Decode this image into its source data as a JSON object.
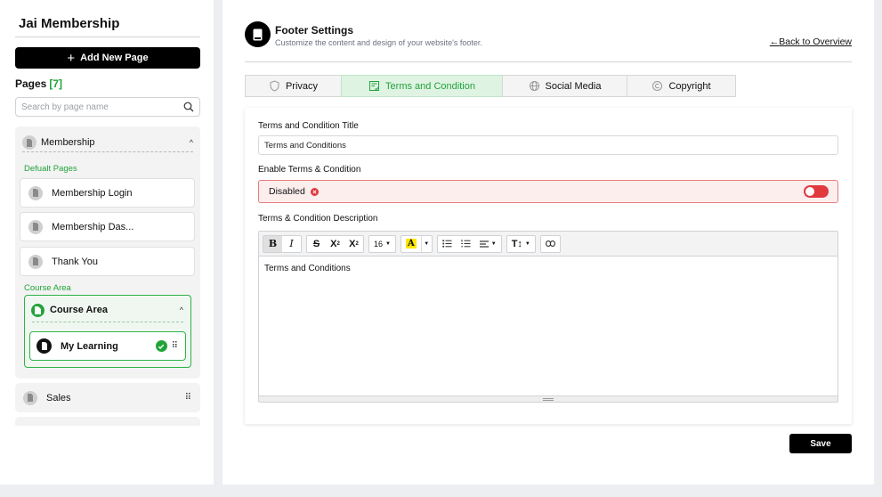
{
  "sidebar": {
    "app_title": "Jai Membership",
    "add_button": "Add New Page",
    "pages_label": "Pages",
    "pages_count": "[7]",
    "search_placeholder": "Search by page name",
    "group": {
      "title": "Membership",
      "default_label": "Defualt Pages",
      "default_pages": [
        "Membership Login",
        "Membership Das...",
        "Thank You"
      ],
      "course_label": "Course Area",
      "course_box_title": "Course Area",
      "course_item": "My Learning"
    },
    "sales": "Sales"
  },
  "header": {
    "title": "Footer Settings",
    "subtitle": "Customize the content and design of your website's footer.",
    "back_link": "Back to Overview"
  },
  "tabs": [
    {
      "label": "Privacy",
      "icon": "shield-icon",
      "active": false
    },
    {
      "label": "Terms and Condition",
      "icon": "document-check-icon",
      "active": true
    },
    {
      "label": "Social Media",
      "icon": "globe-icon",
      "active": false
    },
    {
      "label": "Copyright",
      "icon": "copyright-icon",
      "active": false
    }
  ],
  "form": {
    "title_label": "Terms and Condition Title",
    "title_value": "Terms and Conditions",
    "enable_label": "Enable Terms & Condition",
    "enable_status": "Disabled",
    "enabled": false,
    "description_label": "Terms & Condition Description",
    "description_value": "Terms and Conditions",
    "font_size": "16"
  },
  "save_label": "Save",
  "colors": {
    "accent_green": "#22a33a",
    "danger_red": "#e0393e",
    "primary_black": "#000000"
  }
}
